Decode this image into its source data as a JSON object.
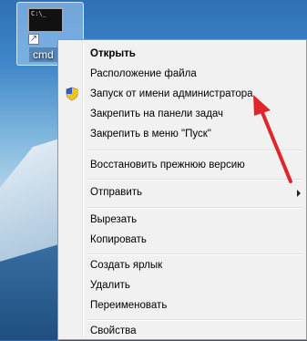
{
  "desktop": {
    "icon_label": "cmd",
    "console_text": "C:\\_"
  },
  "context_menu": {
    "items": [
      {
        "label": "Открыть",
        "bold": true
      },
      {
        "label": "Расположение файла"
      },
      {
        "label": "Запуск от имени администратора",
        "icon": "uac-shield-icon"
      },
      {
        "label": "Закрепить на панели задач"
      },
      {
        "label": "Закрепить в меню \"Пуск\""
      },
      {
        "label": "Восстановить прежнюю версию"
      },
      {
        "label": "Отправить",
        "submenu": true
      },
      {
        "label": "Вырезать"
      },
      {
        "label": "Копировать"
      },
      {
        "label": "Создать ярлык"
      },
      {
        "label": "Удалить"
      },
      {
        "label": "Переименовать"
      },
      {
        "label": "Свойства"
      }
    ]
  },
  "colors": {
    "annotation_arrow": "#e0262b",
    "menu_background": "#f1f1f1"
  }
}
